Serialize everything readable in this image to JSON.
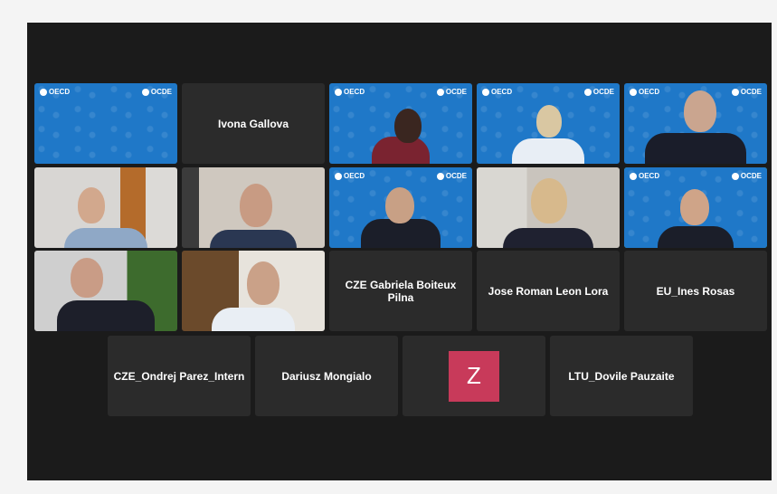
{
  "meeting": {
    "participants": {
      "p_ivona": {
        "name": "Ivona Gallova"
      },
      "p_gabriela": {
        "name": "CZE Gabriela Boiteux Pilna"
      },
      "p_jose": {
        "name": "Jose Roman Leon Lora"
      },
      "p_ines": {
        "name": "EU_Ines Rosas"
      },
      "p_ondrej": {
        "name": "CZE_Ondrej Parez_Intern"
      },
      "p_dariusz": {
        "name": "Dariusz Mongialo"
      },
      "p_z": {
        "initial": "Z"
      },
      "p_dovile": {
        "name": "LTU_Dovile Pauzaite"
      }
    },
    "oecd_logo": {
      "left": "OECD",
      "right": "OCDE"
    }
  },
  "colors": {
    "oecd_blue": "#1f78c8",
    "tile_bg": "#2b2b2b",
    "active_speaker_border": "#7bd32a",
    "avatar_z": "#c83a5a"
  },
  "icons": [
    "oecd-logo-icon"
  ]
}
